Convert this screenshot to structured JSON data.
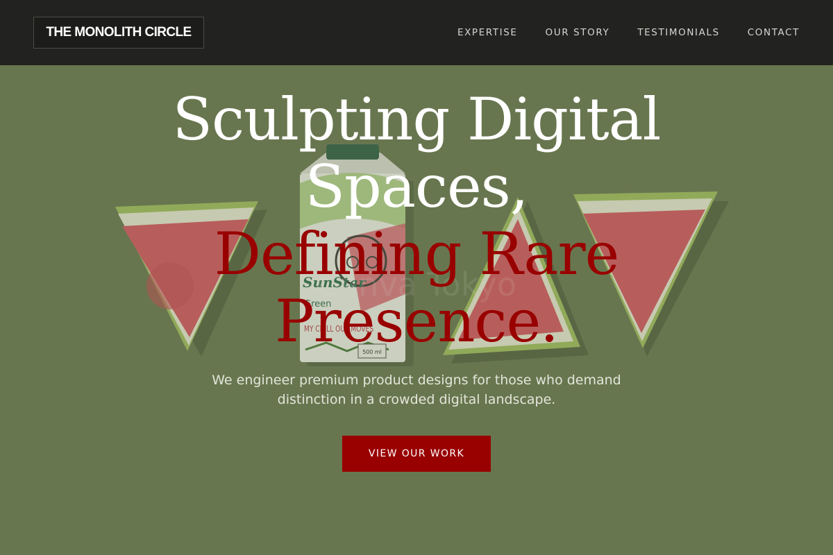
{
  "header": {
    "logo": "THE MONOLITH CIRCLE",
    "nav": [
      {
        "label": "EXPERTISE"
      },
      {
        "label": "OUR STORY"
      },
      {
        "label": "TESTIMONIALS"
      },
      {
        "label": "CONTACT"
      }
    ]
  },
  "hero": {
    "headline_line1": "Sculpting Digital",
    "headline_line2": "Spaces,",
    "headline_line3": "Defining Rare",
    "headline_line4": "Presence.",
    "subtext": "We engineer premium product designs for those who demand distinction in a crowded digital landscape.",
    "cta_label": "VIEW OUR WORK",
    "background_image": {
      "subject": "watermelon-slices-and-juice-carton",
      "carton_brand": "SunStar",
      "carton_text_1": "Green",
      "carton_text_2": "MY CHILL OUT MOVES",
      "carton_volume": "500 ml",
      "watermark": "Canva Tokyo"
    }
  },
  "colors": {
    "header_bg": "#222220",
    "hero_bg": "#68764f",
    "accent_red": "#990000",
    "headline_white": "#ffffff"
  }
}
